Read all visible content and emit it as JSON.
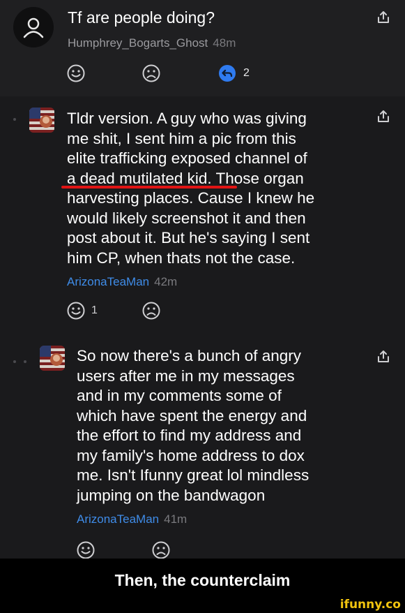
{
  "comments": [
    {
      "title": "Tf are people doing?",
      "username": "Humphrey_Bogarts_Ghost",
      "time": "48m",
      "replies_count": "2"
    },
    {
      "lines": [
        "Tldr version. A guy who was giving",
        "me shit, I sent him a pic from this",
        "elite trafficking exposed channel of",
        "a dead mutilated kid. Those organ",
        "harvesting places. Cause I knew he",
        "would likely screenshot it and then",
        "post about it. But he's saying I sent",
        "him CP, when thats not the case."
      ],
      "username": "ArizonaTeaMan",
      "time": "42m",
      "smile_count": "1"
    },
    {
      "lines": [
        "So now there's a bunch of angry",
        "users after me in my messages",
        "and in my comments some of",
        "which have spent the energy and",
        "the effort to find my address and",
        "my family's home address to dox",
        "me. Isn't Ifunny great lol mindless",
        "jumping on the bandwagon"
      ],
      "username": "ArizonaTeaMan",
      "time": "41m"
    }
  ],
  "caption": "Then, the counterclaim",
  "watermark": "ifunny.co",
  "colors": {
    "background": "#1a1a1c",
    "username_blue": "#3f8ce8",
    "reply_badge": "#2f7bf0",
    "underline": "#e01414",
    "watermark": "#f1c40f"
  }
}
